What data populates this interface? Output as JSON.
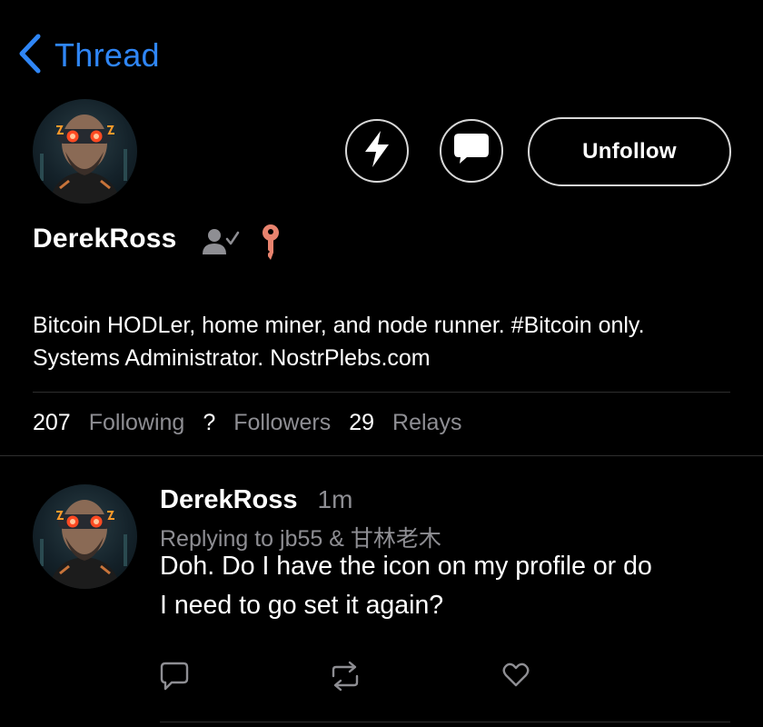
{
  "nav": {
    "back_icon": "chevron-left-icon",
    "title": "Thread"
  },
  "colors": {
    "accent": "#2f86f6",
    "muted": "#8e8e93",
    "key_badge": "#e8836e",
    "background": "#000000"
  },
  "profile": {
    "name": "DerekRoss",
    "badges": [
      "person-check-icon",
      "key-icon"
    ],
    "bio": [
      "Bitcoin HODLer, home miner, and node runner. #Bitcoin only.",
      "Systems Administrator. NostrPlebs.com"
    ],
    "actions": {
      "zap_icon": "lightning-icon",
      "message_icon": "chat-bubble-icon",
      "unfollow_label": "Unfollow"
    },
    "stats": {
      "following_count": "207",
      "following_label": "Following",
      "followers_count": "?",
      "followers_label": "Followers",
      "relays_count": "29",
      "relays_label": "Relays"
    }
  },
  "post": {
    "author": "DerekRoss",
    "time": "1m",
    "replying_to": "Replying to jb55 & 甘林老木",
    "lines": [
      "Doh. Do I have the icon on my profile or do",
      "I need to go set it again?"
    ],
    "actions": [
      "reply-icon",
      "repost-icon",
      "like-icon"
    ]
  }
}
